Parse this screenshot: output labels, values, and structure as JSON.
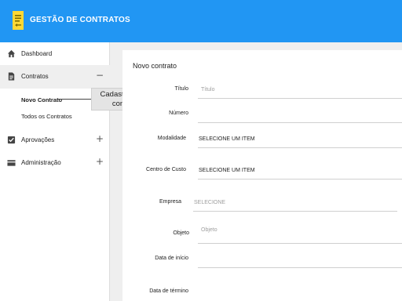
{
  "header": {
    "title": "GESTÃO DE CONTRATOS",
    "logo": "document-icon",
    "color": "#2196f3"
  },
  "sidebar": {
    "items": [
      {
        "label": "Dashboard",
        "icon": "home-icon"
      },
      {
        "label": "Contratos",
        "icon": "document-icon",
        "toggle": "−"
      },
      {
        "label": "Aprovações",
        "icon": "checklist-icon",
        "toggle": "+"
      },
      {
        "label": "Administração",
        "icon": "card-icon",
        "toggle": "+"
      }
    ],
    "sub_items": [
      "Novo Contrato",
      "Todos os Contratos"
    ]
  },
  "tooltip": {
    "text": "Cadastrar novo contrato"
  },
  "form": {
    "title": "Novo contrato",
    "fields": [
      {
        "label": "Título",
        "value": "Título",
        "state": "placeholder"
      },
      {
        "label": "Número",
        "value": "",
        "state": "empty"
      },
      {
        "label": "Modalidade",
        "value": "SELECIONE UM ITEM",
        "state": "selected"
      },
      {
        "label": "Centro de Custo",
        "value": "SELECIONE UM ITEM",
        "state": "selected"
      },
      {
        "label": "Empresa",
        "value": "SELECIONE",
        "state": "placeholder"
      },
      {
        "label": "Objeto",
        "value": "Objeto",
        "state": "placeholder"
      },
      {
        "label": "Data de início",
        "value": "",
        "state": "empty"
      },
      {
        "label": "Data de término",
        "value": "",
        "state": "empty"
      }
    ]
  }
}
